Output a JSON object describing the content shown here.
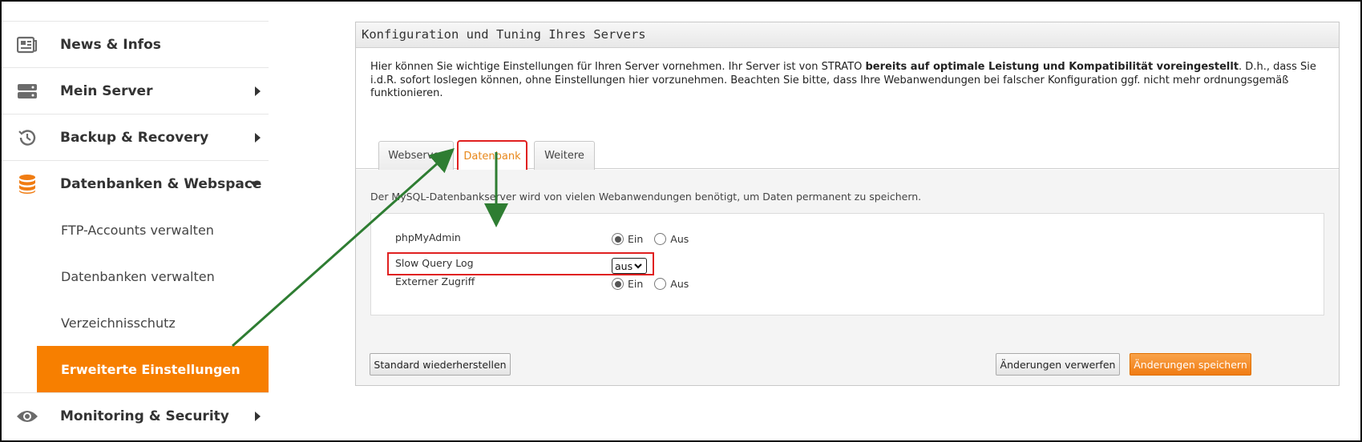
{
  "sidebar": {
    "items": [
      {
        "label": "News & Infos",
        "icon": "news-icon"
      },
      {
        "label": "Mein Server",
        "icon": "server-icon"
      },
      {
        "label": "Backup & Recovery",
        "icon": "history-icon"
      },
      {
        "label": "Datenbanken & Webspace",
        "icon": "database-icon"
      }
    ],
    "subitems": [
      {
        "label": "FTP-Accounts verwalten"
      },
      {
        "label": "Datenbanken verwalten"
      },
      {
        "label": "Verzeichnisschutz"
      },
      {
        "label": "Erweiterte Einstellungen",
        "active": true
      }
    ],
    "bottom_item": {
      "label": "Monitoring & Security",
      "icon": "eye-icon"
    },
    "accent_color": "#f77f00"
  },
  "panel": {
    "title": "Konfiguration und Tuning Ihres Servers",
    "intro_part1": "Hier können Sie wichtige Einstellungen für Ihren Server vornehmen. Ihr Server ist von STRATO ",
    "intro_bold": "bereits auf optimale Leistung und Kompatibilität voreingestellt",
    "intro_part2": ". D.h., dass Sie i.d.R. sofort loslegen können, ohne Einstellungen hier vorzunehmen. Beachten Sie bitte, dass Ihre Webanwendungen bei falscher Konfiguration ggf. nicht mehr ordnungsgemäß funktionieren.",
    "tabs": [
      {
        "label": "Webserver"
      },
      {
        "label": "Datenbank",
        "active": true
      },
      {
        "label": "Weitere"
      }
    ],
    "description": "Der MySQL-Datenbankserver wird von vielen Webanwendungen benötigt, um Daten permanent zu speichern.",
    "settings": {
      "phpmyadmin": {
        "label": "phpMyAdmin",
        "on_label": "Ein",
        "off_label": "Aus",
        "value": "Ein"
      },
      "slow_query_log": {
        "label": "Slow Query Log",
        "value": "aus"
      },
      "externer_zugriff": {
        "label": "Externer Zugriff",
        "on_label": "Ein",
        "off_label": "Aus",
        "value": "Ein"
      }
    },
    "buttons": {
      "reset": "Standard wiederherstellen",
      "discard": "Änderungen verwerfen",
      "save": "Änderungen speichern"
    }
  },
  "annotation_color": "#2e7d32",
  "highlight_color": "#e02020"
}
